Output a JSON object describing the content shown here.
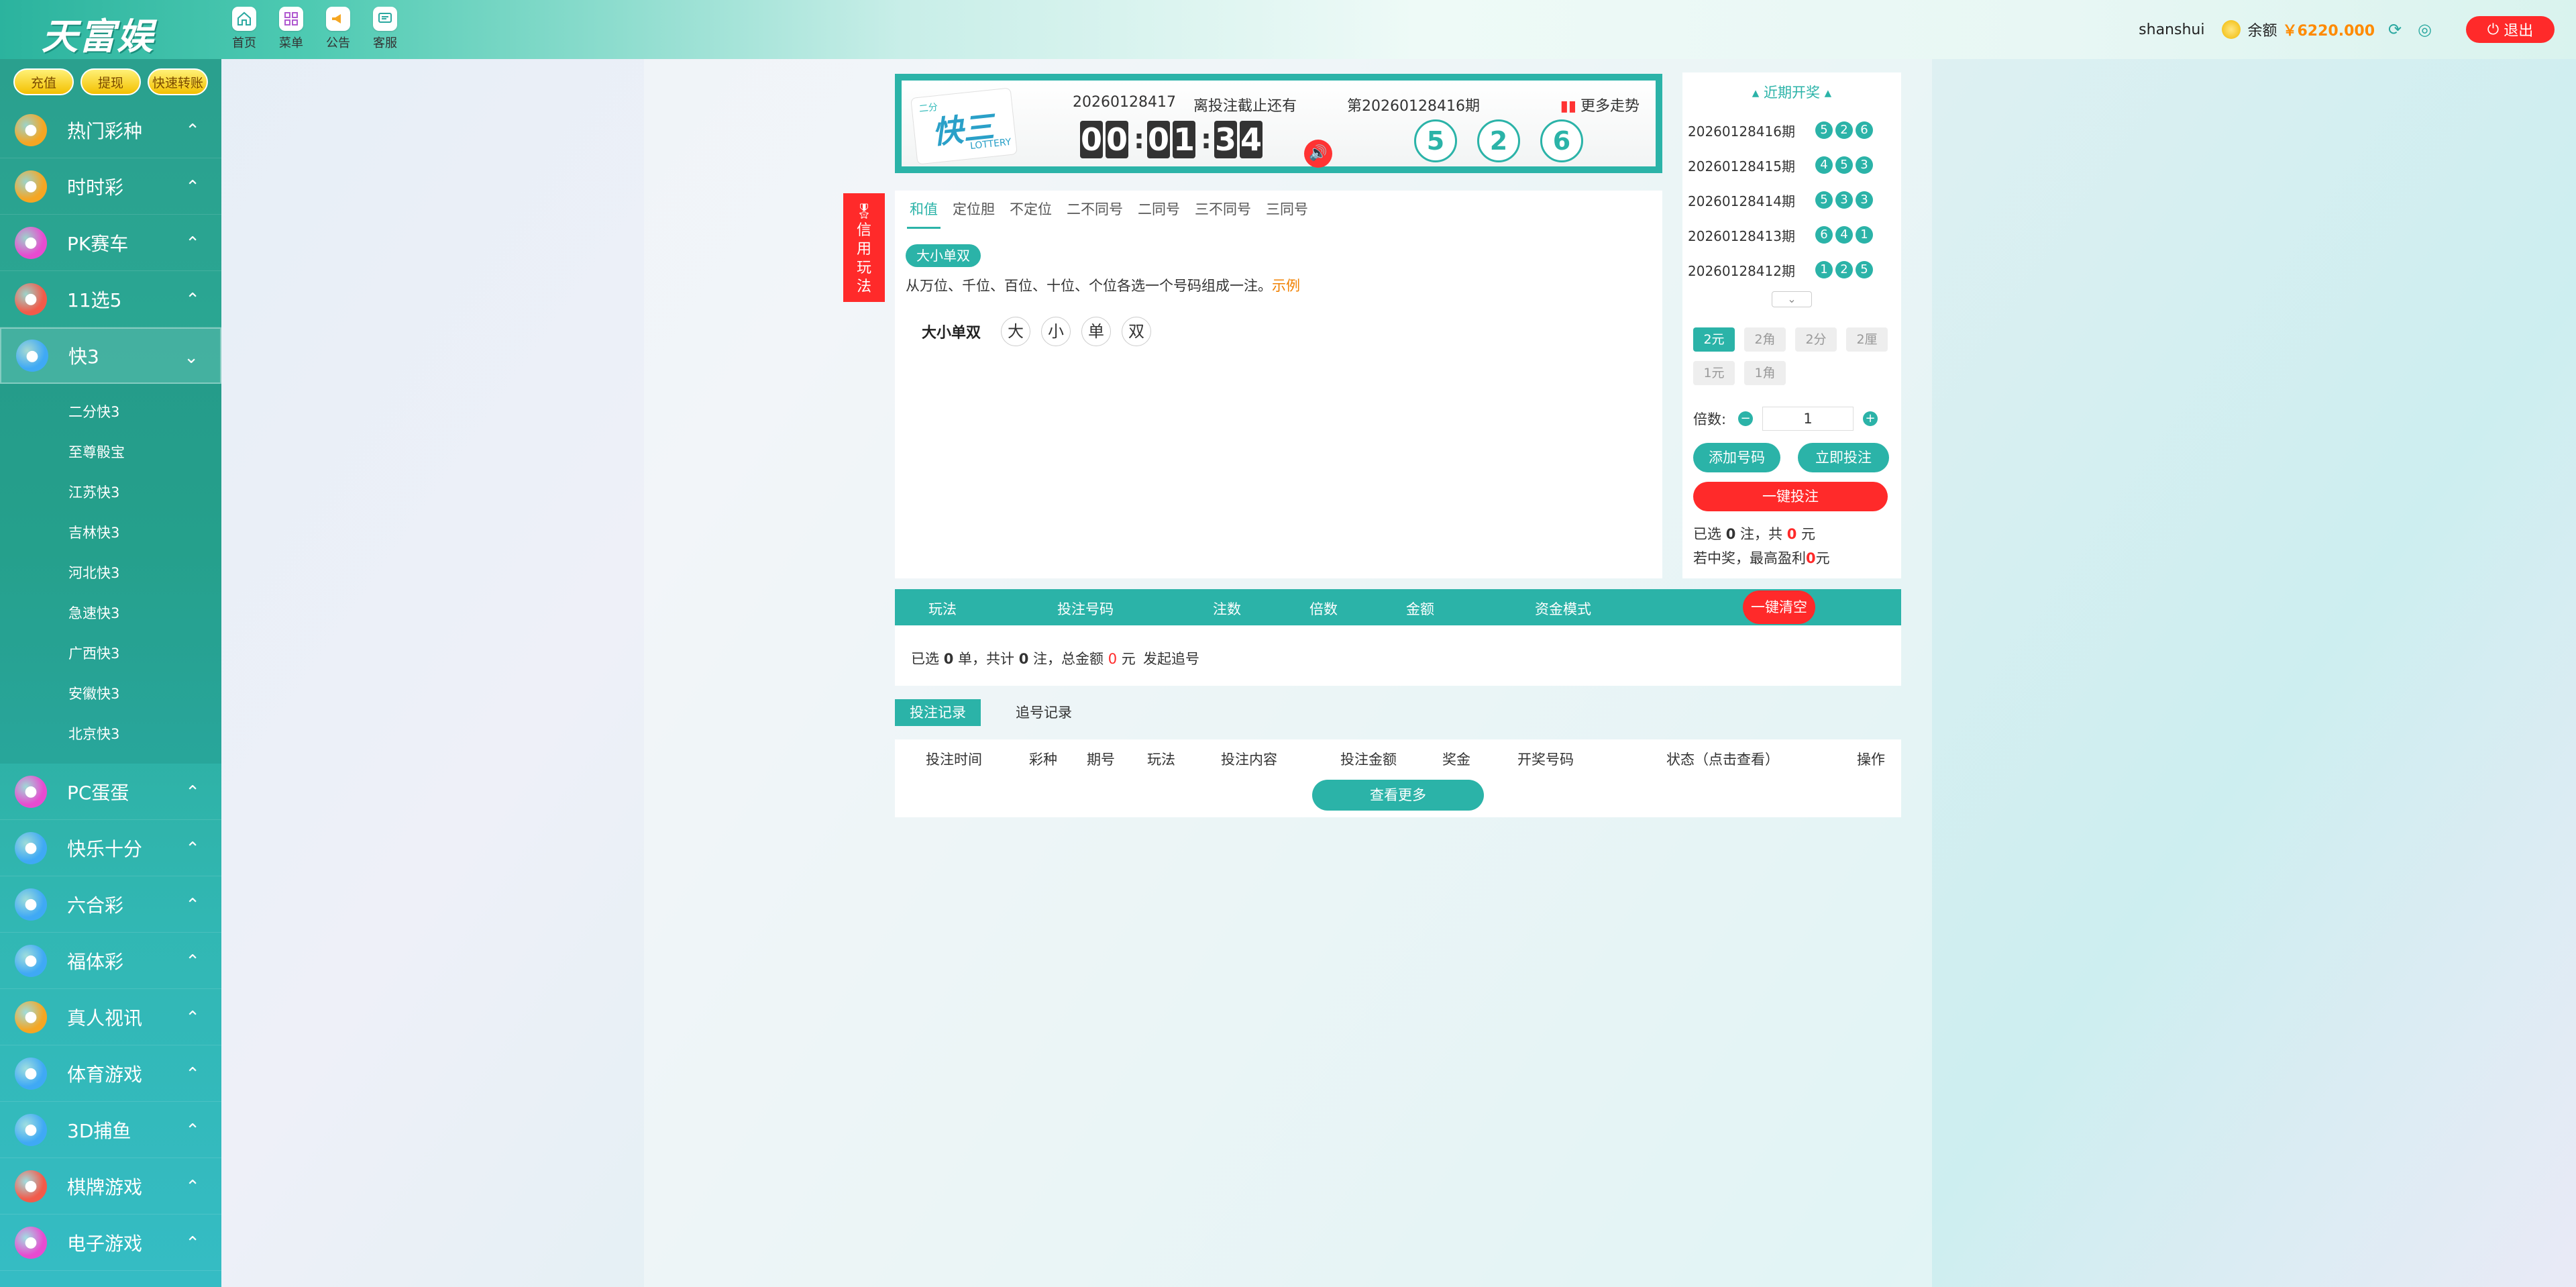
{
  "brand": {
    "logo_text": "天富娱乐",
    "logo_mark": "®"
  },
  "topnav": [
    {
      "label": "首页",
      "icon": "home-icon"
    },
    {
      "label": "菜单",
      "icon": "grid-icon"
    },
    {
      "label": "公告",
      "icon": "megaphone-icon"
    },
    {
      "label": "客服",
      "icon": "chat-icon"
    }
  ],
  "user": {
    "name": "shanshui",
    "balance_label": "余额",
    "balance": "￥6220.000",
    "logout": "退出"
  },
  "sidebar": {
    "quick": [
      "充值",
      "提现",
      "快速转账"
    ],
    "categories_top": [
      {
        "label": "热门彩种",
        "color": "#f5a623"
      },
      {
        "label": "时时彩",
        "color": "#f5a623"
      },
      {
        "label": "PK赛车",
        "color": "#e84bd0"
      },
      {
        "label": "11选5",
        "color": "#f25b4a"
      },
      {
        "label": "快3",
        "color": "#3fa9f5"
      }
    ],
    "sub_items": [
      "二分快3",
      "至尊骰宝",
      "江苏快3",
      "吉林快3",
      "河北快3",
      "急速快3",
      "广西快3",
      "安徽快3",
      "北京快3"
    ],
    "categories_bottom": [
      {
        "label": "PC蛋蛋",
        "color": "#e84bd0"
      },
      {
        "label": "快乐十分",
        "color": "#3fa9f5"
      },
      {
        "label": "六合彩",
        "color": "#3fa9f5"
      },
      {
        "label": "福体彩",
        "color": "#3fa9f5"
      },
      {
        "label": "真人视讯",
        "color": "#f5a623"
      },
      {
        "label": "体育游戏",
        "color": "#3fa9f5"
      },
      {
        "label": "3D捕鱼",
        "color": "#3fa9f5"
      },
      {
        "label": "棋牌游戏",
        "color": "#f25b4a"
      },
      {
        "label": "电子游戏",
        "color": "#e84bd0"
      }
    ]
  },
  "header": {
    "logo_small": "二分",
    "logo_main": "快三",
    "logo_sub": "LOTTERY",
    "issue": "20260128417",
    "deadline_label": "离投注截止还有",
    "timer": [
      "0",
      "0",
      "0",
      "1",
      "3",
      "4"
    ],
    "last_issue": "第20260128416期",
    "more_trend": "更多走势",
    "last_balls": [
      "5",
      "2",
      "6"
    ]
  },
  "flag_text": [
    "信",
    "用",
    "玩",
    "法"
  ],
  "play": {
    "tabs": [
      "和值",
      "定位胆",
      "不定位",
      "二不同号",
      "二同号",
      "三不同号",
      "三同号"
    ],
    "sub_tag": "大小单双",
    "desc": "从万位、千位、百位、十位、个位各选一个号码组成一注。",
    "example": "示例",
    "pick_label": "大小单双",
    "picks": [
      "大",
      "小",
      "单",
      "双"
    ]
  },
  "recent": {
    "title": "近期开奖",
    "rows": [
      {
        "issue": "20260128416期",
        "balls": [
          "5",
          "2",
          "6"
        ]
      },
      {
        "issue": "20260128415期",
        "balls": [
          "4",
          "5",
          "3"
        ]
      },
      {
        "issue": "20260128414期",
        "balls": [
          "5",
          "3",
          "3"
        ]
      },
      {
        "issue": "20260128413期",
        "balls": [
          "6",
          "4",
          "1"
        ]
      },
      {
        "issue": "20260128412期",
        "balls": [
          "1",
          "2",
          "5"
        ]
      }
    ]
  },
  "bet": {
    "units": [
      "2元",
      "2角",
      "2分",
      "2厘",
      "1元",
      "1角"
    ],
    "multiplier_label": "倍数:",
    "multiplier": "1",
    "add_button": "添加号码",
    "bet_now": "立即投注",
    "one_key": "一键投注",
    "selected_pre": "已选",
    "selected_count": "0",
    "selected_mid": "注，共",
    "selected_amount": "0",
    "selected_post": "元",
    "win_pre": "若中奖，最高盈利",
    "win_amount": "0",
    "win_post": "元"
  },
  "betlist": {
    "headers": [
      "玩法",
      "投注号码",
      "注数",
      "倍数",
      "金额",
      "资金模式"
    ],
    "clear": "一键清空",
    "summary_pre": "已选",
    "orders": "0",
    "summary_mid1": "单，共计",
    "notes": "0",
    "summary_mid2": "注，总金额",
    "total": "0",
    "summary_post": "元",
    "chase": "发起追号"
  },
  "records": {
    "tabs": [
      "投注记录",
      "追号记录"
    ],
    "headers": [
      "投注时间",
      "彩种",
      "期号",
      "玩法",
      "投注内容",
      "投注金额",
      "奖金",
      "开奖号码",
      "状态（点击查看）",
      "操作"
    ],
    "more": "查看更多"
  }
}
